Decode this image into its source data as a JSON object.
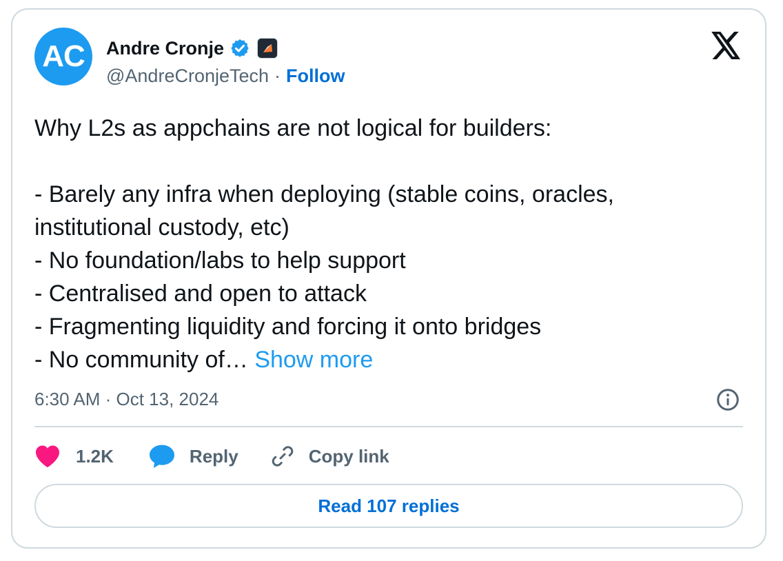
{
  "author": {
    "initials": "AC",
    "name": "Andre Cronje",
    "handle": "@AndreCronjeTech",
    "separator": "·",
    "follow_label": "Follow"
  },
  "tweet": {
    "lines": [
      "Why L2s as appchains are not logical for builders:",
      "",
      "- Barely any infra when deploying (stable coins, oracles,",
      "institutional custody, etc)",
      "- No foundation/labs to help support",
      "- Centralised and open to attack",
      "- Fragmenting liquidity and forcing it onto bridges"
    ],
    "last_line": "- No community of… ",
    "show_more": "Show more",
    "timestamp": "6:30 AM · Oct 13, 2024"
  },
  "actions": {
    "likes_count": "1.2K",
    "reply_label": "Reply",
    "copy_link_label": "Copy link"
  },
  "footer": {
    "read_replies_label": "Read 107 replies"
  },
  "icons": {
    "verified": "verified-badge-icon",
    "affiliate": "affiliate-badge-icon",
    "brand": "x-logo-icon",
    "info": "info-icon",
    "like": "heart-icon",
    "reply": "reply-bubble-icon",
    "copy": "link-icon"
  },
  "colors": {
    "accent": "#1d9bf0",
    "link": "#006fd6",
    "like": "#f91880",
    "muted": "#536471",
    "border": "#cfd9de"
  }
}
